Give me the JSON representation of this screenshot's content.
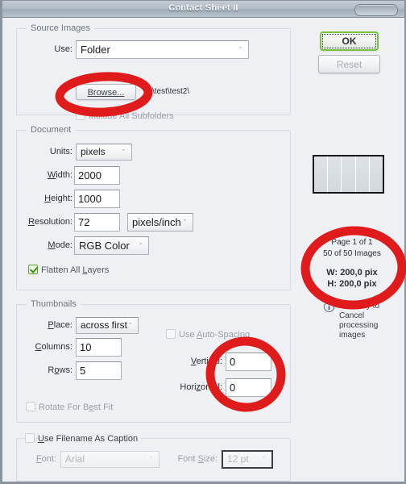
{
  "window": {
    "title": "Contact Sheet II",
    "collapse_widget": "titlebar-pill"
  },
  "buttons": {
    "ok": "OK",
    "reset": "Reset"
  },
  "source_images": {
    "legend": "Source Images",
    "use_label": "Use:",
    "use_value": "Folder",
    "browse_label": "Browse...",
    "path": "D:\\test\\test2\\",
    "include_subfolders_label": "Include All Subfolders",
    "include_subfolders_checked": false
  },
  "document": {
    "legend": "Document",
    "units_label": "Units:",
    "units_value": "pixels",
    "width_label": "Width:",
    "width_value": "2000",
    "height_label": "Height:",
    "height_value": "1000",
    "resolution_label": "Resolution:",
    "resolution_value": "72",
    "resolution_units_value": "pixels/inch",
    "mode_label": "Mode:",
    "mode_value": "RGB Color",
    "flatten_label": "Flatten All Layers",
    "flatten_checked": true
  },
  "thumbnails": {
    "legend": "Thumbnails",
    "place_label": "Place:",
    "place_value": "across first",
    "columns_label": "Columns:",
    "columns_value": "10",
    "rows_label": "Rows:",
    "rows_value": "5",
    "rotate_label": "Rotate For Best Fit",
    "rotate_checked": false,
    "auto_spacing_label": "Use Auto-Spacing",
    "auto_spacing_checked": false,
    "vertical_label": "Vertical:",
    "vertical_value": "0",
    "horizontal_label": "Horizontal:",
    "horizontal_value": "0"
  },
  "caption": {
    "legend": "Use Filename As Caption",
    "checked": false,
    "font_label": "Font:",
    "font_value": "Arial",
    "font_size_label": "Font Size:",
    "font_size_value": "12 pt"
  },
  "preview": {
    "columns": 5,
    "page_text": "Page 1 of 1",
    "images_text": "50 of 50 Images",
    "width_text": "W: 200,0 pix",
    "height_text": "H: 200,0 pix",
    "esc_text": "ESC key to Cancel processing images"
  },
  "colors": {
    "accent_green": "#7ac13c",
    "annotation_red": "#e01b1b",
    "dialog_bg": "#eef0f3",
    "titlebar": "#aeb9c5"
  },
  "icons": {
    "dropdown": "ˇ",
    "info": "i"
  }
}
